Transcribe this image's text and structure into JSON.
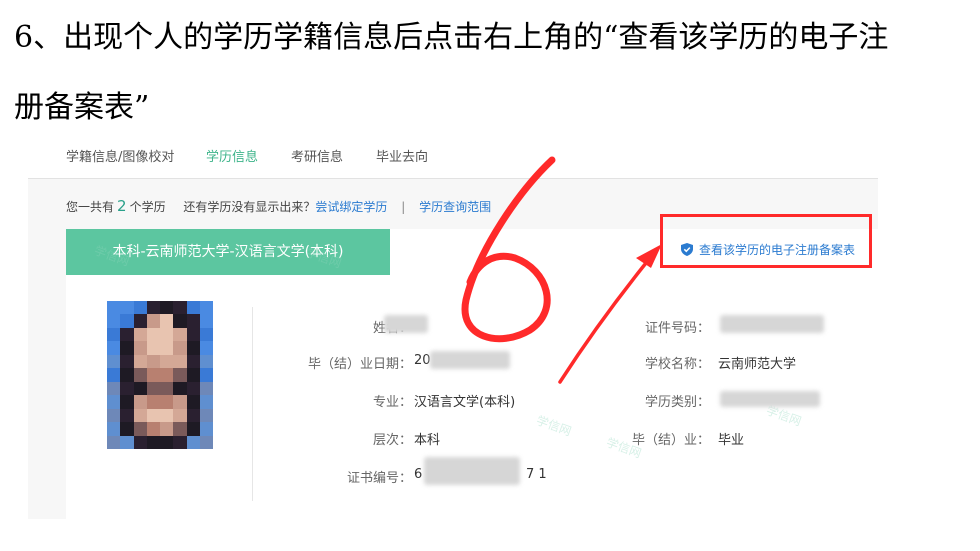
{
  "instruction": {
    "line1": "6、出现个人的学历学籍信息后点击右上角的“查看该学历的电子注",
    "line2": "册备案表”"
  },
  "tabs": [
    "学籍信息/图像校对",
    "学历信息",
    "考研信息",
    "毕业去向"
  ],
  "active_tab": "学历信息",
  "summary": {
    "prefix": "您一共有",
    "count": "2",
    "suffix": "个学历",
    "missing_prompt": "还有学历没有显示出来？",
    "bind_link": "尝试绑定学历",
    "separator": "|",
    "query_range_link": "学历查询范围"
  },
  "record": {
    "title": "本科-云南师范大学-汉语言文学(本科)",
    "view_registration_link": "查看该学历的电子注册备案表",
    "fields": {
      "name_label": "姓名：",
      "id_label": "证件号码：",
      "grad_date_label": "毕（结）业日期：",
      "grad_date_value": "20",
      "school_label": "学校名称：",
      "school_value": "云南师范大学",
      "major_label": "专业：",
      "major_value": "汉语言文学(本科)",
      "category_label": "学历类别：",
      "level_label": "层次：",
      "level_value": "本科",
      "grad_status_label": "毕（结）业：",
      "grad_status_value": "毕业",
      "cert_label": "证书编号：",
      "cert_value_start": "6",
      "cert_value_end": "7 1"
    },
    "watermark": "学信网"
  },
  "annotation": {
    "number": "6",
    "color": "#ff2a2a"
  },
  "colors": {
    "green": "#5cc6a0",
    "active_tab": "#3db48a",
    "link": "#2b7bd0"
  }
}
